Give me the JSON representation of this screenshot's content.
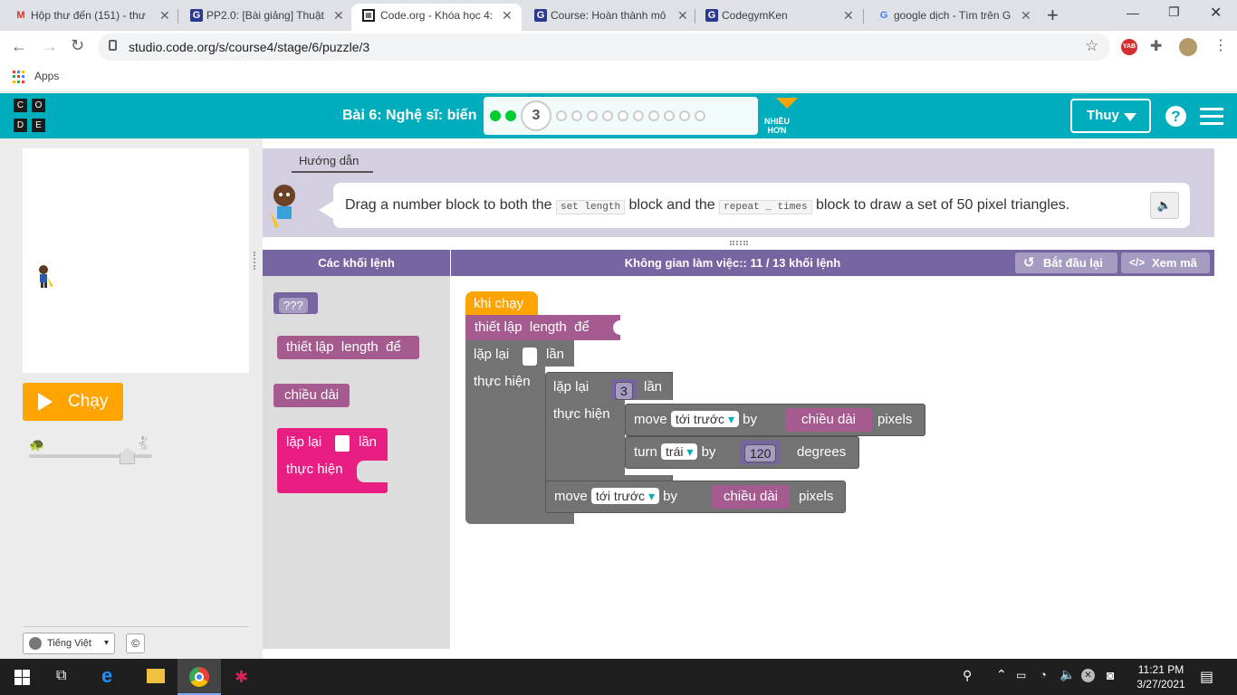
{
  "browser": {
    "tabs": [
      {
        "label": "Hộp thư đến (151) - thư",
        "icon": "gmail-icon",
        "active": false
      },
      {
        "label": "PP2.0: [Bài giảng] Thuật",
        "icon": "codegym-icon",
        "active": false
      },
      {
        "label": "Code.org - Khóa học 4:",
        "icon": "codeorg-icon",
        "active": true
      },
      {
        "label": "Course: Hoàn thành mô",
        "icon": "codegym-icon",
        "active": false
      },
      {
        "label": "CodegymKen",
        "icon": "codegym-icon",
        "active": false
      },
      {
        "label": "google dịch - Tìm trên G",
        "icon": "google-icon",
        "active": false
      }
    ],
    "url": "studio.code.org/s/course4/stage/6/puzzle/3",
    "bookmarks": {
      "apps_label": "Apps"
    }
  },
  "header": {
    "logo_letters": [
      "C",
      "O",
      "D",
      "E"
    ],
    "lesson_title": "Bài 6: Nghệ sĩ: biến",
    "current_puzzle": "3",
    "total_dots": 13,
    "completed_dots": 2,
    "more_label_1": "NHIỀU",
    "more_label_2": "HƠN",
    "user_name": "Thuy",
    "colors": {
      "header_bg": "#00adbc",
      "done_dot": "#00cc33",
      "accent": "#ffa400"
    }
  },
  "left": {
    "run_label": "Chạy",
    "language": "Tiếng Việt"
  },
  "instructions": {
    "tab_label": "Hướng dẫn",
    "text_1": "Drag a number block to both the",
    "code_1": "set length",
    "text_2": "block and the",
    "code_2": "repeat _ times",
    "text_3": "block to draw a set of 50 pixel triangles."
  },
  "toolbox": {
    "title": "Các khối lệnh",
    "blocks": {
      "number": "???",
      "set_prefix": "thiết lập",
      "set_var": "length",
      "set_to": "để",
      "length_var": "chiều dài",
      "repeat": "lặp lại",
      "times": "lần",
      "do": "thực hiện"
    }
  },
  "workspace": {
    "title": "Không gian làm việc:: 11 / 13 khối lệnh",
    "reset_label": "Bắt đầu lại",
    "code_label": "Xem mã",
    "blocks": {
      "when_run": "khi chạy",
      "set_prefix": "thiết lập",
      "set_var": "length",
      "set_to": "để",
      "repeat": "lặp lại",
      "times": "lần",
      "do": "thực hiện",
      "inner_count": "3",
      "move": "move",
      "forward": "tới trước",
      "by": "by",
      "length_var": "chiều dài",
      "pixels": "pixels",
      "turn": "turn",
      "left_dir": "trái",
      "angle": "120",
      "degrees": "degrees"
    }
  },
  "taskbar": {
    "time": "11:21 PM",
    "date": "3/27/2021"
  }
}
